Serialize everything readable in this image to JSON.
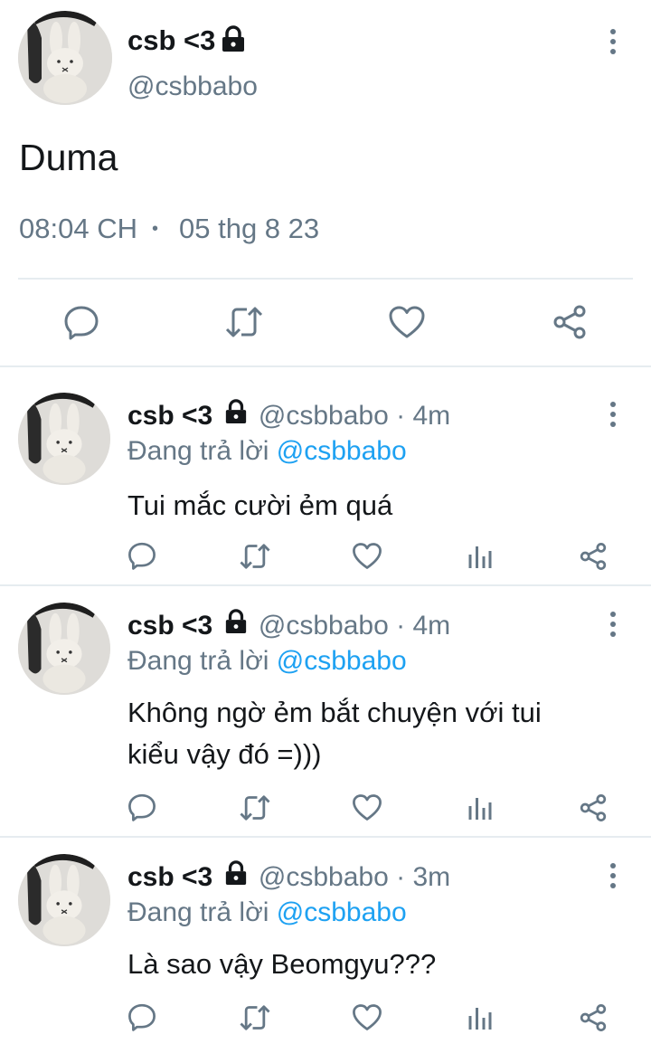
{
  "main_tweet": {
    "display_name": "csb <3",
    "handle": "@csbbabo",
    "text": "Duma",
    "time": "08:04 CH",
    "separator": "•",
    "date": "05 thg 8 23"
  },
  "replies": [
    {
      "display_name": "csb <3",
      "handle": "@csbbabo",
      "age": "· 4m",
      "replying_prefix": "Đang trả lời",
      "replying_to": "@csbbabo",
      "text_lines": [
        "Tui mắc cười ẻm quá"
      ]
    },
    {
      "display_name": "csb <3",
      "handle": "@csbbabo",
      "age": "· 4m",
      "replying_prefix": "Đang trả lời",
      "replying_to": "@csbbabo",
      "text_lines": [
        "Không ngờ ẻm bắt chuyện với tui",
        "kiểu vậy đó =)))"
      ]
    },
    {
      "display_name": "csb <3",
      "handle": "@csbbabo",
      "age": "· 3m",
      "replying_prefix": "Đang trả lời",
      "replying_to": "@csbbabo",
      "text_lines": [
        "Là sao vậy Beomgyu???"
      ]
    }
  ],
  "icons": {
    "reply": "reply-icon",
    "retweet": "retweet-icon",
    "like": "like-icon",
    "analytics": "analytics-icon",
    "share": "share-icon",
    "lock": "lock-icon",
    "more": "more-icon"
  },
  "colors": {
    "text": "#14171a",
    "muted": "#657786",
    "link": "#1da1f2",
    "divider": "#e6ecf0"
  }
}
